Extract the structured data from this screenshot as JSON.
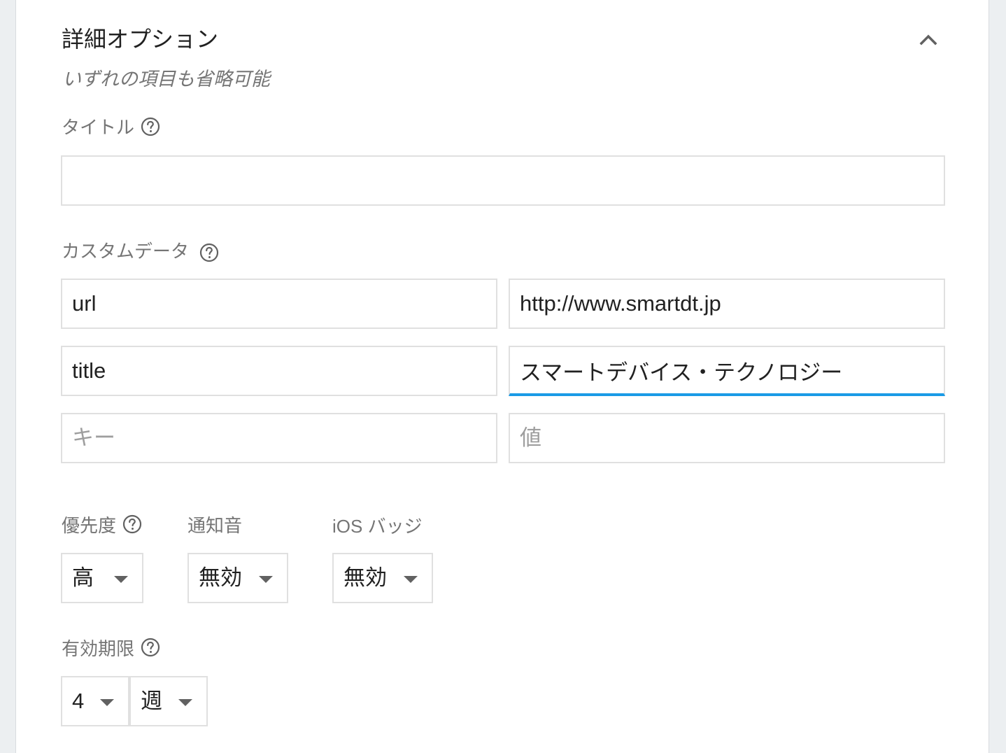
{
  "panel": {
    "title": "詳細オプション",
    "subtitle": "いずれの項目も省略可能",
    "collapse_icon": "chevron-up-icon"
  },
  "title_field": {
    "label": "タイトル",
    "value": "",
    "help_icon": "help-circle-icon"
  },
  "custom_data": {
    "label": "カスタムデータ",
    "help_icon": "help-circle-icon",
    "rows": [
      {
        "key": "url",
        "value": "http://www.smartdt.jp"
      },
      {
        "key": "title",
        "value": "スマートデバイス・テクノロジー"
      }
    ],
    "key_placeholder": "キー",
    "value_placeholder": "値",
    "focus_color": "#1a9be6"
  },
  "priority": {
    "label": "優先度",
    "value": "高",
    "help_icon": "help-circle-icon"
  },
  "sound": {
    "label": "通知音",
    "value": "無効"
  },
  "ios_badge": {
    "label": "iOS バッジ",
    "value": "無効"
  },
  "expiration": {
    "label": "有効期限",
    "help_icon": "help-circle-icon",
    "amount": "4",
    "unit": "週"
  }
}
